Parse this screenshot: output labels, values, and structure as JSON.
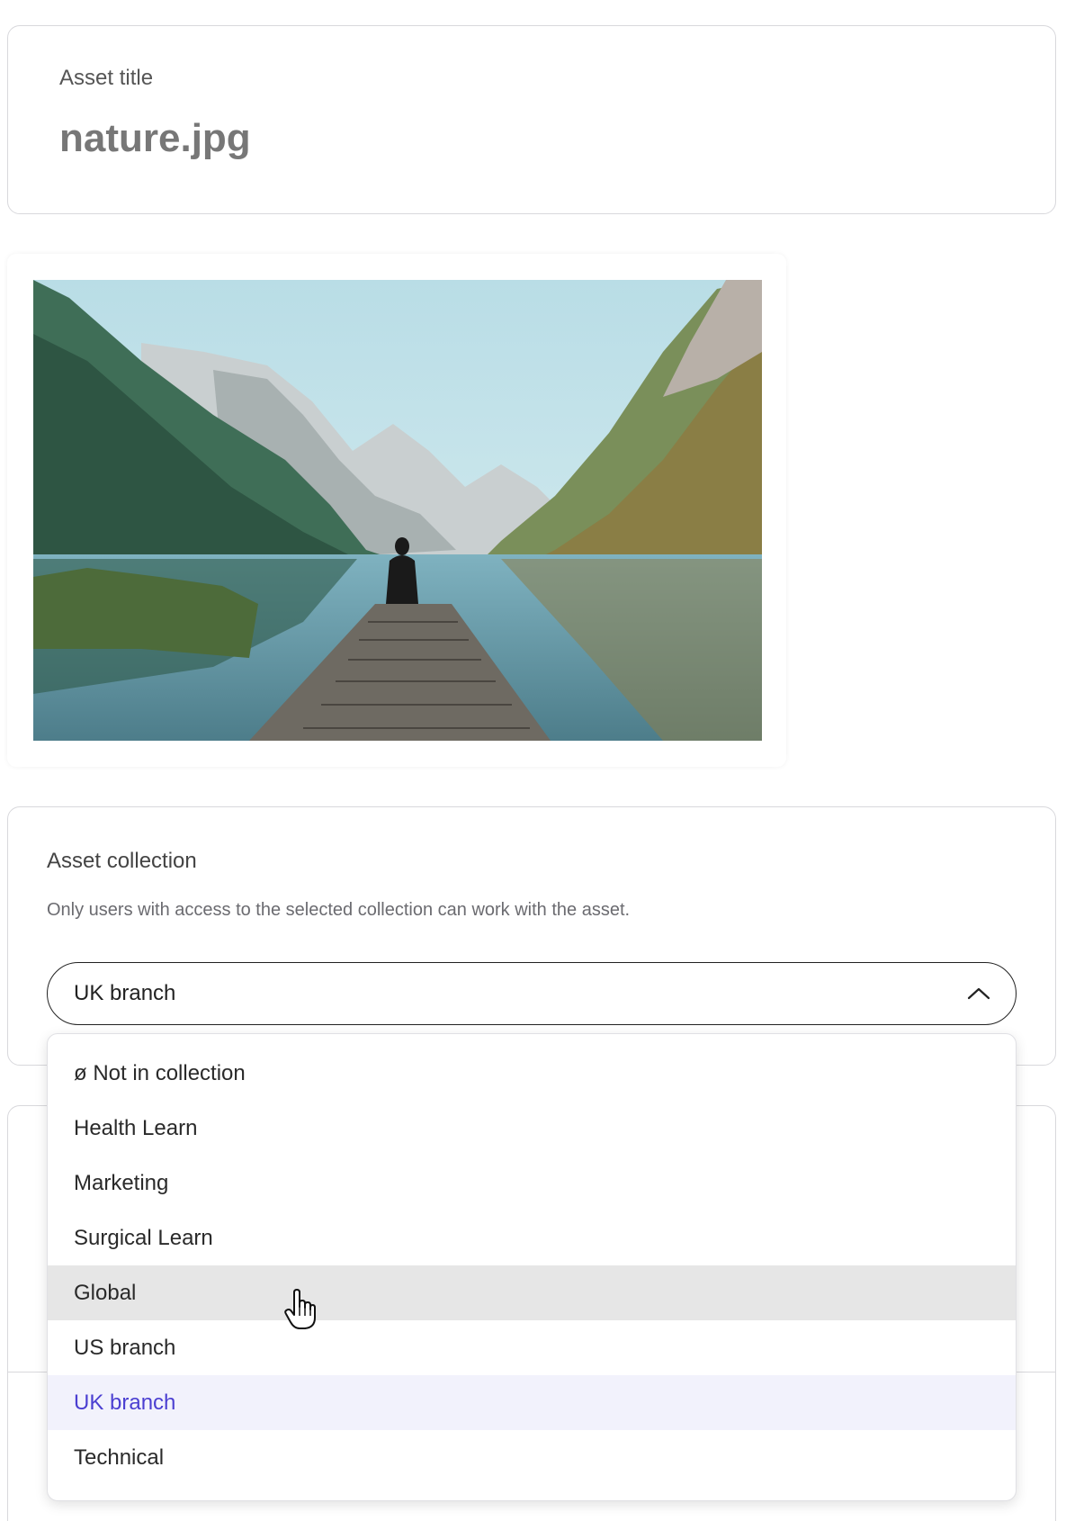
{
  "title_section": {
    "label": "Asset title",
    "value": "nature.jpg"
  },
  "preview": {
    "alt": "Lake landscape with person sitting on wooden pier between mountains"
  },
  "collection_section": {
    "label": "Asset collection",
    "help_text": "Only users with access to the selected collection can work with the asset.",
    "selected_value": "UK branch",
    "options": [
      {
        "label": "ø Not in collection",
        "state": "normal"
      },
      {
        "label": "Health Learn",
        "state": "normal"
      },
      {
        "label": "Marketing",
        "state": "normal"
      },
      {
        "label": "Surgical Learn",
        "state": "normal"
      },
      {
        "label": "Global",
        "state": "hovered"
      },
      {
        "label": "US branch",
        "state": "normal"
      },
      {
        "label": "UK branch",
        "state": "selected"
      },
      {
        "label": "Technical",
        "state": "normal"
      }
    ]
  },
  "colors": {
    "accent": "#4b3fd1",
    "hover_bg": "#e6e6e6",
    "selected_bg": "#f2f2fc"
  },
  "icons": {
    "select_toggle": "chevron-up-icon",
    "cursor": "hand-pointer-icon"
  }
}
